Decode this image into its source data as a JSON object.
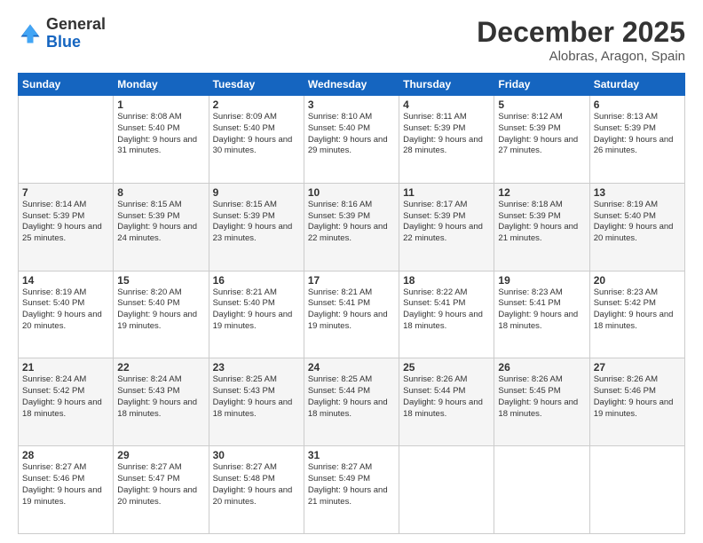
{
  "logo": {
    "general": "General",
    "blue": "Blue"
  },
  "title": "December 2025",
  "location": "Alobras, Aragon, Spain",
  "days_of_week": [
    "Sunday",
    "Monday",
    "Tuesday",
    "Wednesday",
    "Thursday",
    "Friday",
    "Saturday"
  ],
  "weeks": [
    [
      {
        "day": "",
        "sunrise": "",
        "sunset": "",
        "daylight": ""
      },
      {
        "day": "1",
        "sunrise": "Sunrise: 8:08 AM",
        "sunset": "Sunset: 5:40 PM",
        "daylight": "Daylight: 9 hours and 31 minutes."
      },
      {
        "day": "2",
        "sunrise": "Sunrise: 8:09 AM",
        "sunset": "Sunset: 5:40 PM",
        "daylight": "Daylight: 9 hours and 30 minutes."
      },
      {
        "day": "3",
        "sunrise": "Sunrise: 8:10 AM",
        "sunset": "Sunset: 5:40 PM",
        "daylight": "Daylight: 9 hours and 29 minutes."
      },
      {
        "day": "4",
        "sunrise": "Sunrise: 8:11 AM",
        "sunset": "Sunset: 5:39 PM",
        "daylight": "Daylight: 9 hours and 28 minutes."
      },
      {
        "day": "5",
        "sunrise": "Sunrise: 8:12 AM",
        "sunset": "Sunset: 5:39 PM",
        "daylight": "Daylight: 9 hours and 27 minutes."
      },
      {
        "day": "6",
        "sunrise": "Sunrise: 8:13 AM",
        "sunset": "Sunset: 5:39 PM",
        "daylight": "Daylight: 9 hours and 26 minutes."
      }
    ],
    [
      {
        "day": "7",
        "sunrise": "Sunrise: 8:14 AM",
        "sunset": "Sunset: 5:39 PM",
        "daylight": "Daylight: 9 hours and 25 minutes."
      },
      {
        "day": "8",
        "sunrise": "Sunrise: 8:15 AM",
        "sunset": "Sunset: 5:39 PM",
        "daylight": "Daylight: 9 hours and 24 minutes."
      },
      {
        "day": "9",
        "sunrise": "Sunrise: 8:15 AM",
        "sunset": "Sunset: 5:39 PM",
        "daylight": "Daylight: 9 hours and 23 minutes."
      },
      {
        "day": "10",
        "sunrise": "Sunrise: 8:16 AM",
        "sunset": "Sunset: 5:39 PM",
        "daylight": "Daylight: 9 hours and 22 minutes."
      },
      {
        "day": "11",
        "sunrise": "Sunrise: 8:17 AM",
        "sunset": "Sunset: 5:39 PM",
        "daylight": "Daylight: 9 hours and 22 minutes."
      },
      {
        "day": "12",
        "sunrise": "Sunrise: 8:18 AM",
        "sunset": "Sunset: 5:39 PM",
        "daylight": "Daylight: 9 hours and 21 minutes."
      },
      {
        "day": "13",
        "sunrise": "Sunrise: 8:19 AM",
        "sunset": "Sunset: 5:40 PM",
        "daylight": "Daylight: 9 hours and 20 minutes."
      }
    ],
    [
      {
        "day": "14",
        "sunrise": "Sunrise: 8:19 AM",
        "sunset": "Sunset: 5:40 PM",
        "daylight": "Daylight: 9 hours and 20 minutes."
      },
      {
        "day": "15",
        "sunrise": "Sunrise: 8:20 AM",
        "sunset": "Sunset: 5:40 PM",
        "daylight": "Daylight: 9 hours and 19 minutes."
      },
      {
        "day": "16",
        "sunrise": "Sunrise: 8:21 AM",
        "sunset": "Sunset: 5:40 PM",
        "daylight": "Daylight: 9 hours and 19 minutes."
      },
      {
        "day": "17",
        "sunrise": "Sunrise: 8:21 AM",
        "sunset": "Sunset: 5:41 PM",
        "daylight": "Daylight: 9 hours and 19 minutes."
      },
      {
        "day": "18",
        "sunrise": "Sunrise: 8:22 AM",
        "sunset": "Sunset: 5:41 PM",
        "daylight": "Daylight: 9 hours and 18 minutes."
      },
      {
        "day": "19",
        "sunrise": "Sunrise: 8:23 AM",
        "sunset": "Sunset: 5:41 PM",
        "daylight": "Daylight: 9 hours and 18 minutes."
      },
      {
        "day": "20",
        "sunrise": "Sunrise: 8:23 AM",
        "sunset": "Sunset: 5:42 PM",
        "daylight": "Daylight: 9 hours and 18 minutes."
      }
    ],
    [
      {
        "day": "21",
        "sunrise": "Sunrise: 8:24 AM",
        "sunset": "Sunset: 5:42 PM",
        "daylight": "Daylight: 9 hours and 18 minutes."
      },
      {
        "day": "22",
        "sunrise": "Sunrise: 8:24 AM",
        "sunset": "Sunset: 5:43 PM",
        "daylight": "Daylight: 9 hours and 18 minutes."
      },
      {
        "day": "23",
        "sunrise": "Sunrise: 8:25 AM",
        "sunset": "Sunset: 5:43 PM",
        "daylight": "Daylight: 9 hours and 18 minutes."
      },
      {
        "day": "24",
        "sunrise": "Sunrise: 8:25 AM",
        "sunset": "Sunset: 5:44 PM",
        "daylight": "Daylight: 9 hours and 18 minutes."
      },
      {
        "day": "25",
        "sunrise": "Sunrise: 8:26 AM",
        "sunset": "Sunset: 5:44 PM",
        "daylight": "Daylight: 9 hours and 18 minutes."
      },
      {
        "day": "26",
        "sunrise": "Sunrise: 8:26 AM",
        "sunset": "Sunset: 5:45 PM",
        "daylight": "Daylight: 9 hours and 18 minutes."
      },
      {
        "day": "27",
        "sunrise": "Sunrise: 8:26 AM",
        "sunset": "Sunset: 5:46 PM",
        "daylight": "Daylight: 9 hours and 19 minutes."
      }
    ],
    [
      {
        "day": "28",
        "sunrise": "Sunrise: 8:27 AM",
        "sunset": "Sunset: 5:46 PM",
        "daylight": "Daylight: 9 hours and 19 minutes."
      },
      {
        "day": "29",
        "sunrise": "Sunrise: 8:27 AM",
        "sunset": "Sunset: 5:47 PM",
        "daylight": "Daylight: 9 hours and 20 minutes."
      },
      {
        "day": "30",
        "sunrise": "Sunrise: 8:27 AM",
        "sunset": "Sunset: 5:48 PM",
        "daylight": "Daylight: 9 hours and 20 minutes."
      },
      {
        "day": "31",
        "sunrise": "Sunrise: 8:27 AM",
        "sunset": "Sunset: 5:49 PM",
        "daylight": "Daylight: 9 hours and 21 minutes."
      },
      {
        "day": "",
        "sunrise": "",
        "sunset": "",
        "daylight": ""
      },
      {
        "day": "",
        "sunrise": "",
        "sunset": "",
        "daylight": ""
      },
      {
        "day": "",
        "sunrise": "",
        "sunset": "",
        "daylight": ""
      }
    ]
  ]
}
